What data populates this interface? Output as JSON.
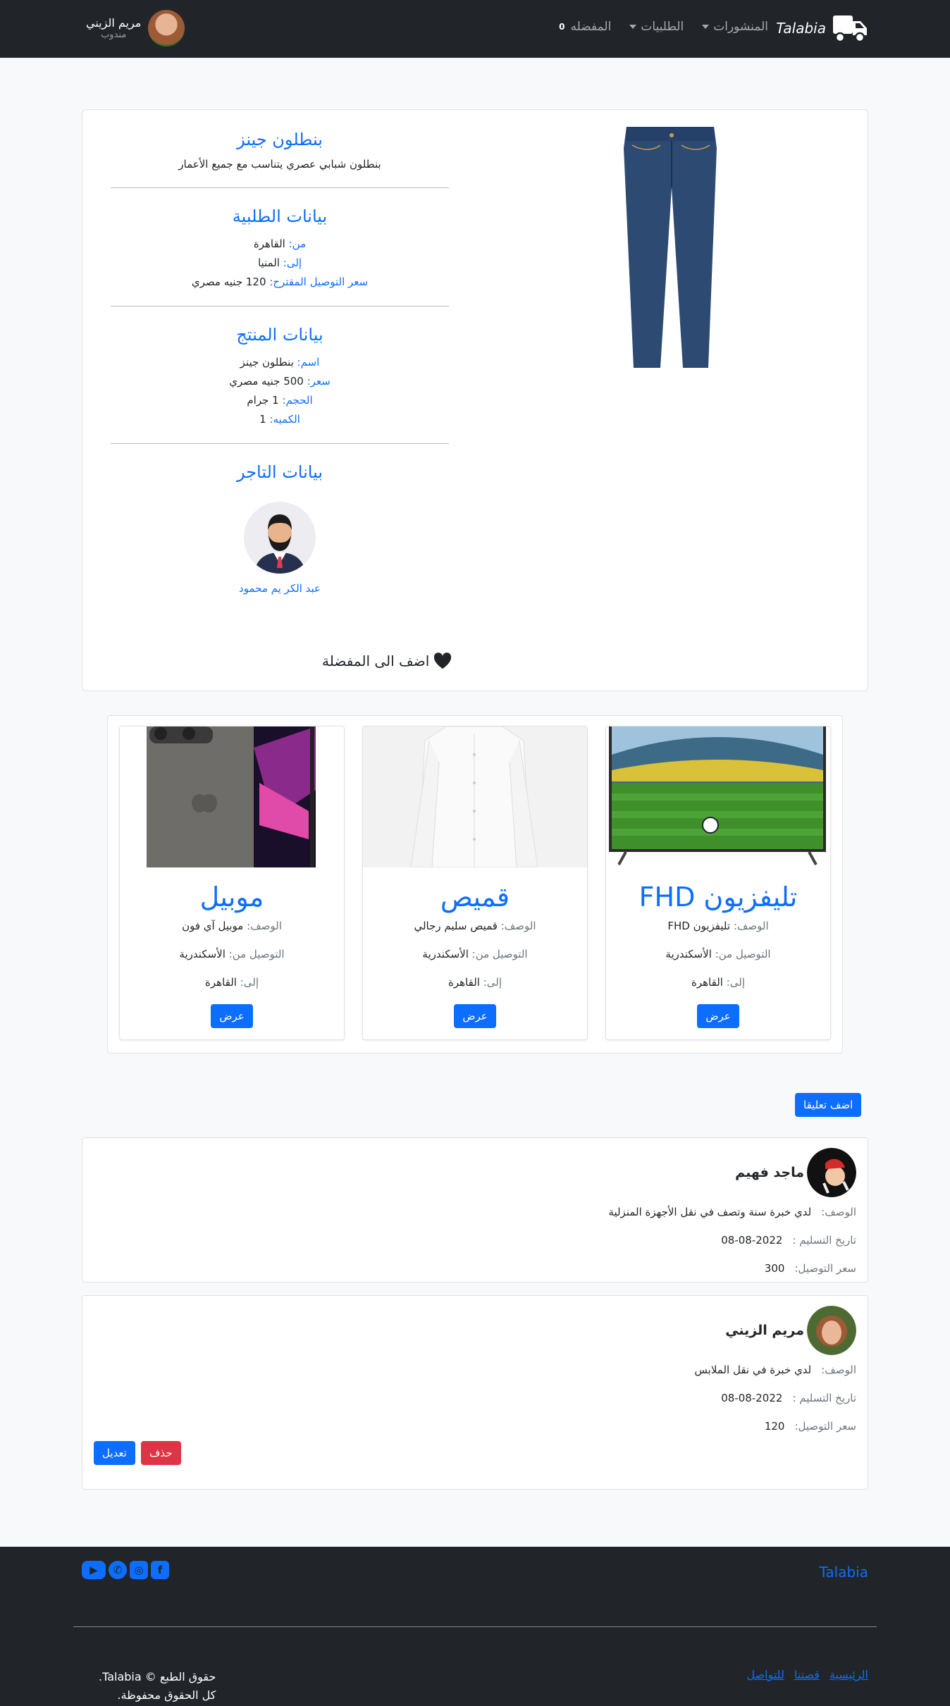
{
  "navbar": {
    "brand": "Talabia",
    "links": {
      "posts": "المنشورات",
      "orders": "الطلبيات",
      "favorites": "المفضله",
      "favorites_count": "0"
    },
    "user": {
      "name": "مريم الزيني",
      "role": "مندوب"
    }
  },
  "product": {
    "title": "بنطلون جينز",
    "description": "بنطلون شبابي عصري يتناسب مع جميع الأعمار",
    "order_section_title": "بيانات الطلبية",
    "order": {
      "from_label": "من:",
      "from": "القاهرة",
      "to_label": "إلى:",
      "to": "المنيا",
      "price_label": "سعر التوصيل المقترح:",
      "price": "120 جنيه مصري"
    },
    "product_section_title": "بيانات المنتج",
    "details": {
      "name_label": "اسم:",
      "name": "بنطلون جينز",
      "price_label": "سعر:",
      "price": "500 جنيه مصري",
      "size_label": "الحجم:",
      "size": "1 جرام",
      "qty_label": "الكميه:",
      "qty": "1"
    },
    "merchant_section_title": "بيانات التاجر",
    "merchant_name": "عبد الكر يم محمود",
    "add_favorite": "اضف الى المفضلة"
  },
  "related": [
    {
      "title": "تليفزيون FHD",
      "desc_label": "الوصف:",
      "desc": "تليفزيون FHD",
      "from_label": "التوصيل من:",
      "from": "الأسكندرية",
      "to_label": "إلى:",
      "to": "القاهرة",
      "button": "عرض"
    },
    {
      "title": "قميص",
      "desc_label": "الوصف:",
      "desc": "قميص سليم رجالي",
      "from_label": "التوصيل من:",
      "from": "الأسكندرية",
      "to_label": "إلى:",
      "to": "القاهرة",
      "button": "عرض"
    },
    {
      "title": "موبيل",
      "desc_label": "الوصف:",
      "desc": "موبيل آي فون",
      "from_label": "التوصيل من:",
      "from": "الأسكندرية",
      "to_label": "إلى:",
      "to": "القاهرة",
      "button": "عرض"
    }
  ],
  "comments_section": {
    "add_button": "اضف تعليقا"
  },
  "comments": [
    {
      "name": "ماجد فهيم",
      "desc_label": "الوصف:",
      "desc": "لدي خبرة سنة وتصف في نقل الأجهزة المنزلية",
      "date_label": "تاريخ التسليم :",
      "date": "2022-08-08",
      "price_label": "سعر التوصيل:",
      "price": "300"
    },
    {
      "name": "مريم الزيني",
      "desc_label": "الوصف:",
      "desc": "لدي خبرة في نقل الملابس",
      "date_label": "تاريخ التسليم :",
      "date": "2022-08-08",
      "price_label": "سعر التوصيل:",
      "price": "120",
      "edit": "تعديل",
      "delete": "حذف"
    }
  ],
  "footer": {
    "brand": "Talabia",
    "links": {
      "home": "الرئيسية",
      "about": "قصتنا",
      "contact": "للتواصل"
    },
    "copyright": "حقوق الطبع © Talabia.",
    "rights": "كل الحقوق محفوظة.",
    "socials": [
      "facebook-icon",
      "instagram-icon",
      "whatsapp-icon",
      "youtube-icon"
    ]
  },
  "colors": {
    "primary": "#0d6efd",
    "dark": "#212529",
    "danger": "#dc3545"
  }
}
